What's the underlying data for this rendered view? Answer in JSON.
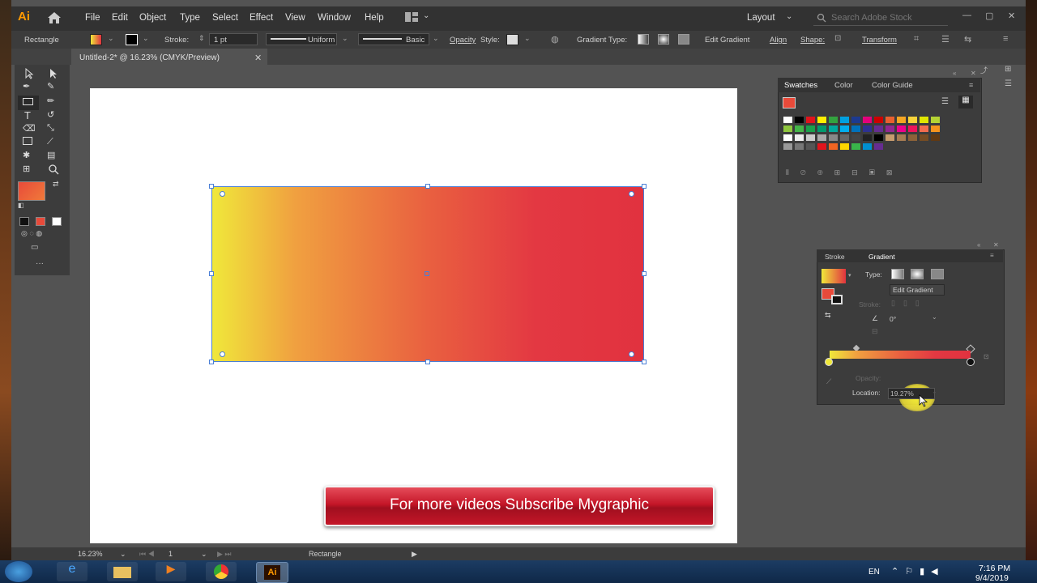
{
  "app": {
    "logo": "Ai"
  },
  "menu": [
    "File",
    "Edit",
    "Object",
    "Type",
    "Select",
    "Effect",
    "View",
    "Window",
    "Help"
  ],
  "workspace": {
    "label": "Layout"
  },
  "search": {
    "placeholder": "Search Adobe Stock"
  },
  "control_bar": {
    "object_type": "Rectangle",
    "stroke_label": "Stroke:",
    "stroke_weight": "1 pt",
    "profile": "Uniform",
    "brush": "Basic",
    "opacity_label": "Opacity",
    "style_label": "Style:",
    "gradient_type_label": "Gradient Type:",
    "edit_gradient": "Edit Gradient",
    "align": "Align",
    "shape": "Shape:",
    "transform": "Transform"
  },
  "document": {
    "tab_title": "Untitled-2* @ 16.23% (CMYK/Preview)"
  },
  "banner": {
    "text": "For more videos Subscribe Mygraphic"
  },
  "swatches_panel": {
    "tabs": [
      "Swatches",
      "Color",
      "Color Guide"
    ]
  },
  "gradient_panel": {
    "tabs": [
      "Stroke",
      "Gradient"
    ],
    "type_label": "Type:",
    "edit_gradient": "Edit Gradient",
    "stroke_label": "Stroke:",
    "angle": "0°",
    "opacity_label": "Opacity:",
    "location_label": "Location:",
    "location_value": "19.27%"
  },
  "status_bar": {
    "zoom": "16.23%",
    "artboard": "1",
    "tool": "Rectangle"
  },
  "taskbar": {
    "lang": "EN",
    "time": "7:16 PM",
    "date": "9/4/2019"
  },
  "colors": {
    "gradient_start": "#f0e83a",
    "gradient_end": "#e1323f",
    "banner": "#c41628",
    "accent": "#4a7fd6"
  }
}
